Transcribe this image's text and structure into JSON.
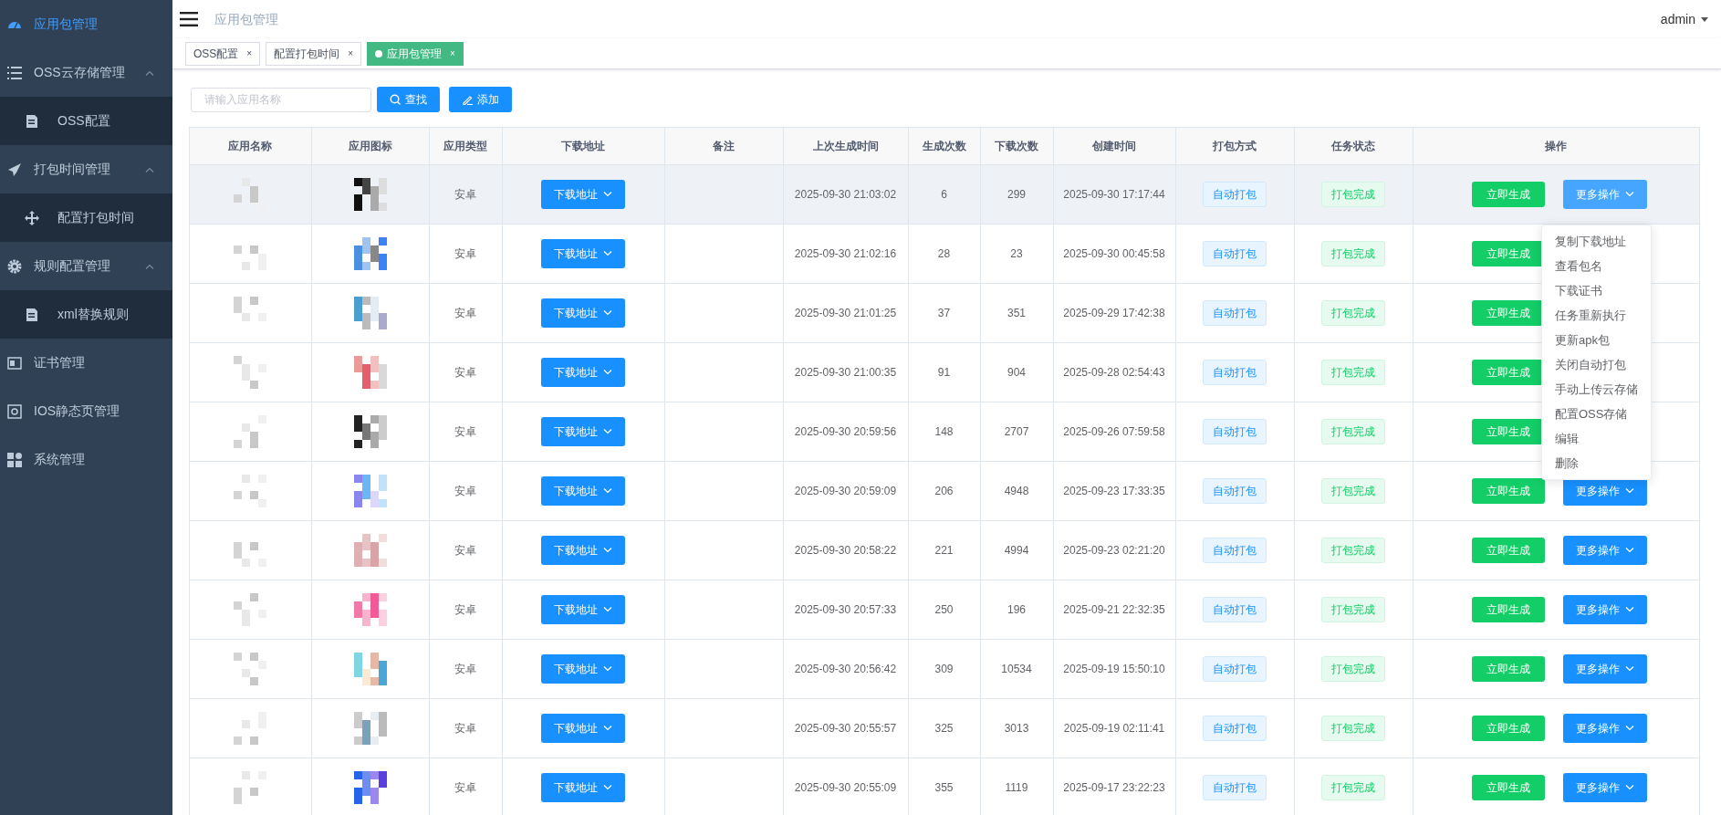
{
  "sidebar": {
    "items": [
      {
        "label": "应用包管理",
        "selected": true,
        "expanded": false
      },
      {
        "label": "OSS云存储管理",
        "selected": false,
        "expanded": true,
        "children": [
          {
            "label": "OSS配置",
            "selected": false
          }
        ]
      },
      {
        "label": "打包时间管理",
        "selected": false,
        "expanded": true,
        "children": [
          {
            "label": "配置打包时间",
            "selected": false
          }
        ]
      },
      {
        "label": "规则配置管理",
        "selected": false,
        "expanded": true,
        "children": [
          {
            "label": "xml替换规则",
            "selected": false
          }
        ]
      },
      {
        "label": "证书管理",
        "selected": false,
        "expanded": false
      },
      {
        "label": "IOS静态页管理",
        "selected": false,
        "expanded": false
      },
      {
        "label": "系统管理",
        "selected": false,
        "expanded": false
      }
    ]
  },
  "header": {
    "breadcrumb": "应用包管理",
    "user": "admin"
  },
  "tabs": [
    {
      "label": "OSS配置",
      "close": "×",
      "selected": false
    },
    {
      "label": "配置打包时间",
      "close": "×",
      "selected": false
    },
    {
      "label": "应用包管理",
      "close": "×",
      "selected": true
    }
  ],
  "search": {
    "placeholder": "请输入应用名称",
    "search_button": "查找",
    "add_button": "添加"
  },
  "table": {
    "columns": [
      "应用名称",
      "应用图标",
      "应用类型",
      "下载地址",
      "备注",
      "上次生成时间",
      "生成次数",
      "下载次数",
      "创建时间",
      "打包方式",
      "任务状态",
      "操作"
    ],
    "rows": [
      {
        "highlighted": true,
        "type": "安卓",
        "download": "下载地址",
        "last_time": "2025-09-30 21:03:02",
        "gen_count": "6",
        "dl_count": "299",
        "created": "2025-09-30 17:17:44",
        "mode": "自动打包",
        "status": "打包完成",
        "generate": "立即生成",
        "more": "更多操作",
        "more_active": true
      },
      {
        "highlighted": false,
        "type": "安卓",
        "download": "下载地址",
        "last_time": "2025-09-30 21:02:16",
        "gen_count": "28",
        "dl_count": "23",
        "created": "2025-09-30 00:45:58",
        "mode": "自动打包",
        "status": "打包完成",
        "generate": "立即生成"
      },
      {
        "highlighted": false,
        "type": "安卓",
        "download": "下载地址",
        "last_time": "2025-09-30 21:01:25",
        "gen_count": "37",
        "dl_count": "351",
        "created": "2025-09-29 17:42:38",
        "mode": "自动打包",
        "status": "打包完成",
        "generate": "立即生成"
      },
      {
        "highlighted": false,
        "type": "安卓",
        "download": "下载地址",
        "last_time": "2025-09-30 21:00:35",
        "gen_count": "91",
        "dl_count": "904",
        "created": "2025-09-28 02:54:43",
        "mode": "自动打包",
        "status": "打包完成",
        "generate": "立即生成"
      },
      {
        "highlighted": false,
        "type": "安卓",
        "download": "下载地址",
        "last_time": "2025-09-30 20:59:56",
        "gen_count": "148",
        "dl_count": "2707",
        "created": "2025-09-26 07:59:58",
        "mode": "自动打包",
        "status": "打包完成",
        "generate": "立即生成"
      },
      {
        "highlighted": false,
        "type": "安卓",
        "download": "下载地址",
        "last_time": "2025-09-30 20:59:09",
        "gen_count": "206",
        "dl_count": "4948",
        "created": "2025-09-23 17:33:35",
        "mode": "自动打包",
        "status": "打包完成",
        "generate": "立即生成",
        "more": "更多操作",
        "more_active": false
      },
      {
        "highlighted": false,
        "type": "安卓",
        "download": "下载地址",
        "last_time": "2025-09-30 20:58:22",
        "gen_count": "221",
        "dl_count": "4994",
        "created": "2025-09-23 02:21:20",
        "mode": "自动打包",
        "status": "打包完成",
        "generate": "立即生成",
        "more": "更多操作",
        "more_active": false
      },
      {
        "highlighted": false,
        "type": "安卓",
        "download": "下载地址",
        "last_time": "2025-09-30 20:57:33",
        "gen_count": "250",
        "dl_count": "196",
        "created": "2025-09-21 22:32:35",
        "mode": "自动打包",
        "status": "打包完成",
        "generate": "立即生成",
        "more": "更多操作",
        "more_active": false
      },
      {
        "highlighted": false,
        "type": "安卓",
        "download": "下载地址",
        "last_time": "2025-09-30 20:56:42",
        "gen_count": "309",
        "dl_count": "10534",
        "created": "2025-09-19 15:50:10",
        "mode": "自动打包",
        "status": "打包完成",
        "generate": "立即生成",
        "more": "更多操作",
        "more_active": false
      },
      {
        "highlighted": false,
        "type": "安卓",
        "download": "下载地址",
        "last_time": "2025-09-30 20:55:57",
        "gen_count": "325",
        "dl_count": "3013",
        "created": "2025-09-19 02:11:41",
        "mode": "自动打包",
        "status": "打包完成",
        "generate": "立即生成",
        "more": "更多操作",
        "more_active": false
      },
      {
        "highlighted": false,
        "type": "安卓",
        "download": "下载地址",
        "last_time": "2025-09-30 20:55:09",
        "gen_count": "355",
        "dl_count": "1119",
        "created": "2025-09-17 23:22:23",
        "mode": "自动打包",
        "status": "打包完成",
        "generate": "立即生成",
        "more": "更多操作",
        "more_active": false
      }
    ]
  },
  "dropdown": {
    "items": [
      "复制下载地址",
      "查看包名",
      "下载证书",
      "任务重新执行",
      "更新apk包",
      "关闭自动打包",
      "手动上传云存储",
      "配置OSS存储",
      "编辑",
      "删除"
    ]
  }
}
